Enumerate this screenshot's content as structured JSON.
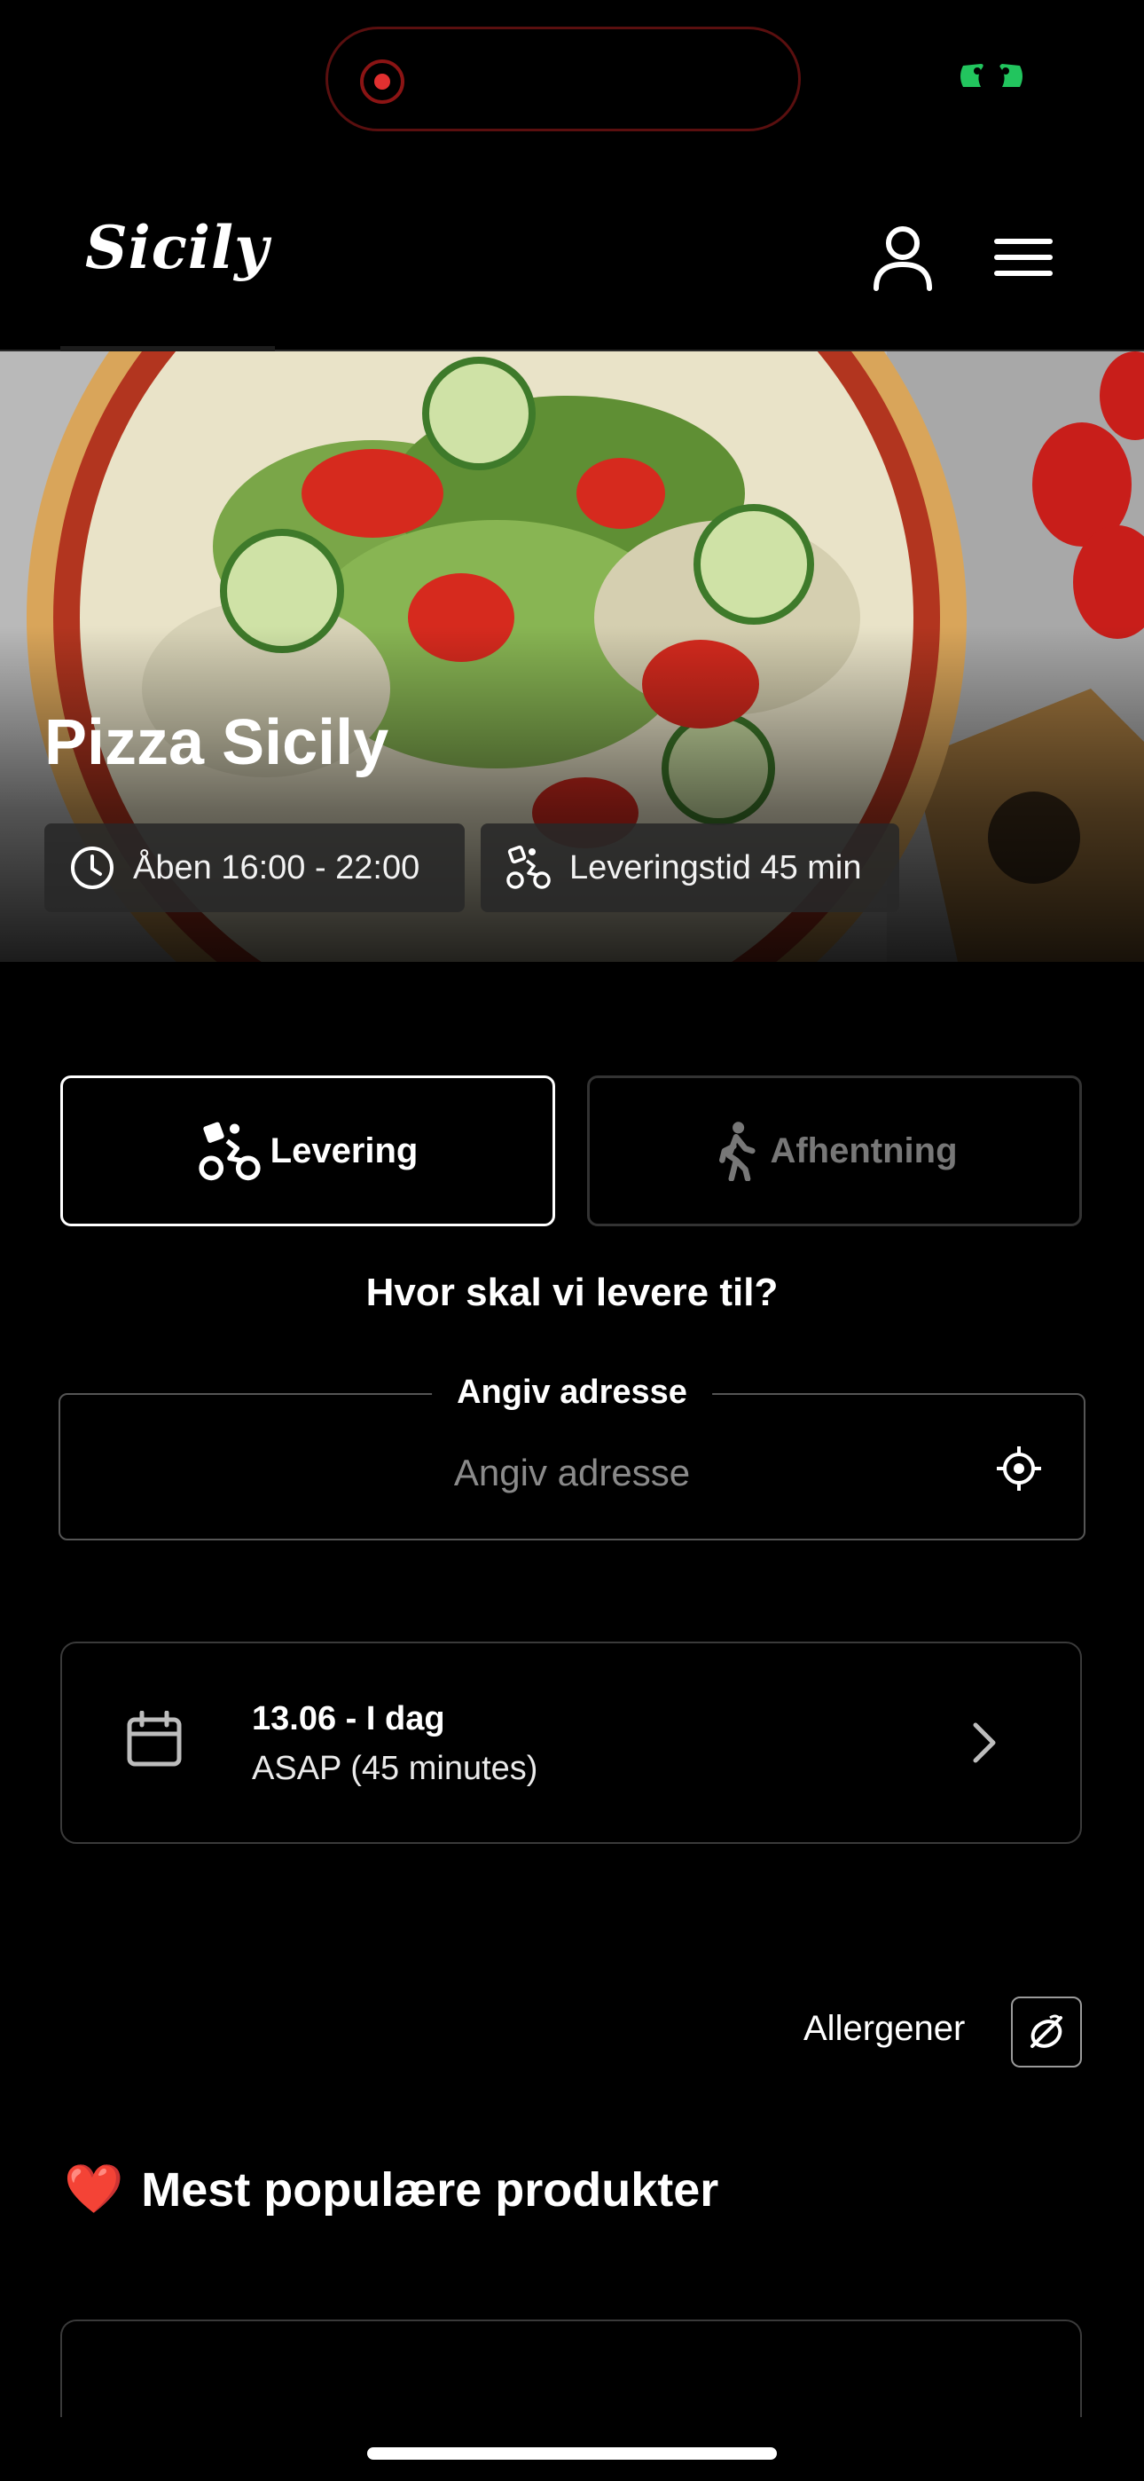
{
  "app": {
    "logo_text": "Sicily"
  },
  "hero": {
    "title": "Pizza Sicily",
    "open_hours": "Åben 16:00 - 22:00",
    "delivery_time": "Leveringstid 45 min"
  },
  "mode": {
    "delivery_label": "Levering",
    "pickup_label": "Afhentning",
    "selected": "delivery"
  },
  "address": {
    "question": "Hvor skal vi levere til?",
    "label": "Angiv adresse",
    "placeholder": "Angiv adresse",
    "value": ""
  },
  "schedule": {
    "date": "13.06 - I dag",
    "time": "ASAP (45 minutes)"
  },
  "allergens": {
    "label": "Allergener"
  },
  "popular": {
    "emoji": "❤️",
    "title": "Mest populære produkter"
  },
  "colors": {
    "background": "#000000",
    "accent_red": "#e13030",
    "status_green": "#22c55e"
  },
  "icons": {
    "user": "user-icon",
    "menu": "hamburger-menu-icon",
    "clock": "clock-icon",
    "bike": "bike-delivery-icon",
    "walk": "walking-person-icon",
    "locate": "crosshair-locate-icon",
    "calendar": "calendar-icon",
    "chevron": "chevron-right-icon",
    "allergen": "no-allergen-icon"
  }
}
